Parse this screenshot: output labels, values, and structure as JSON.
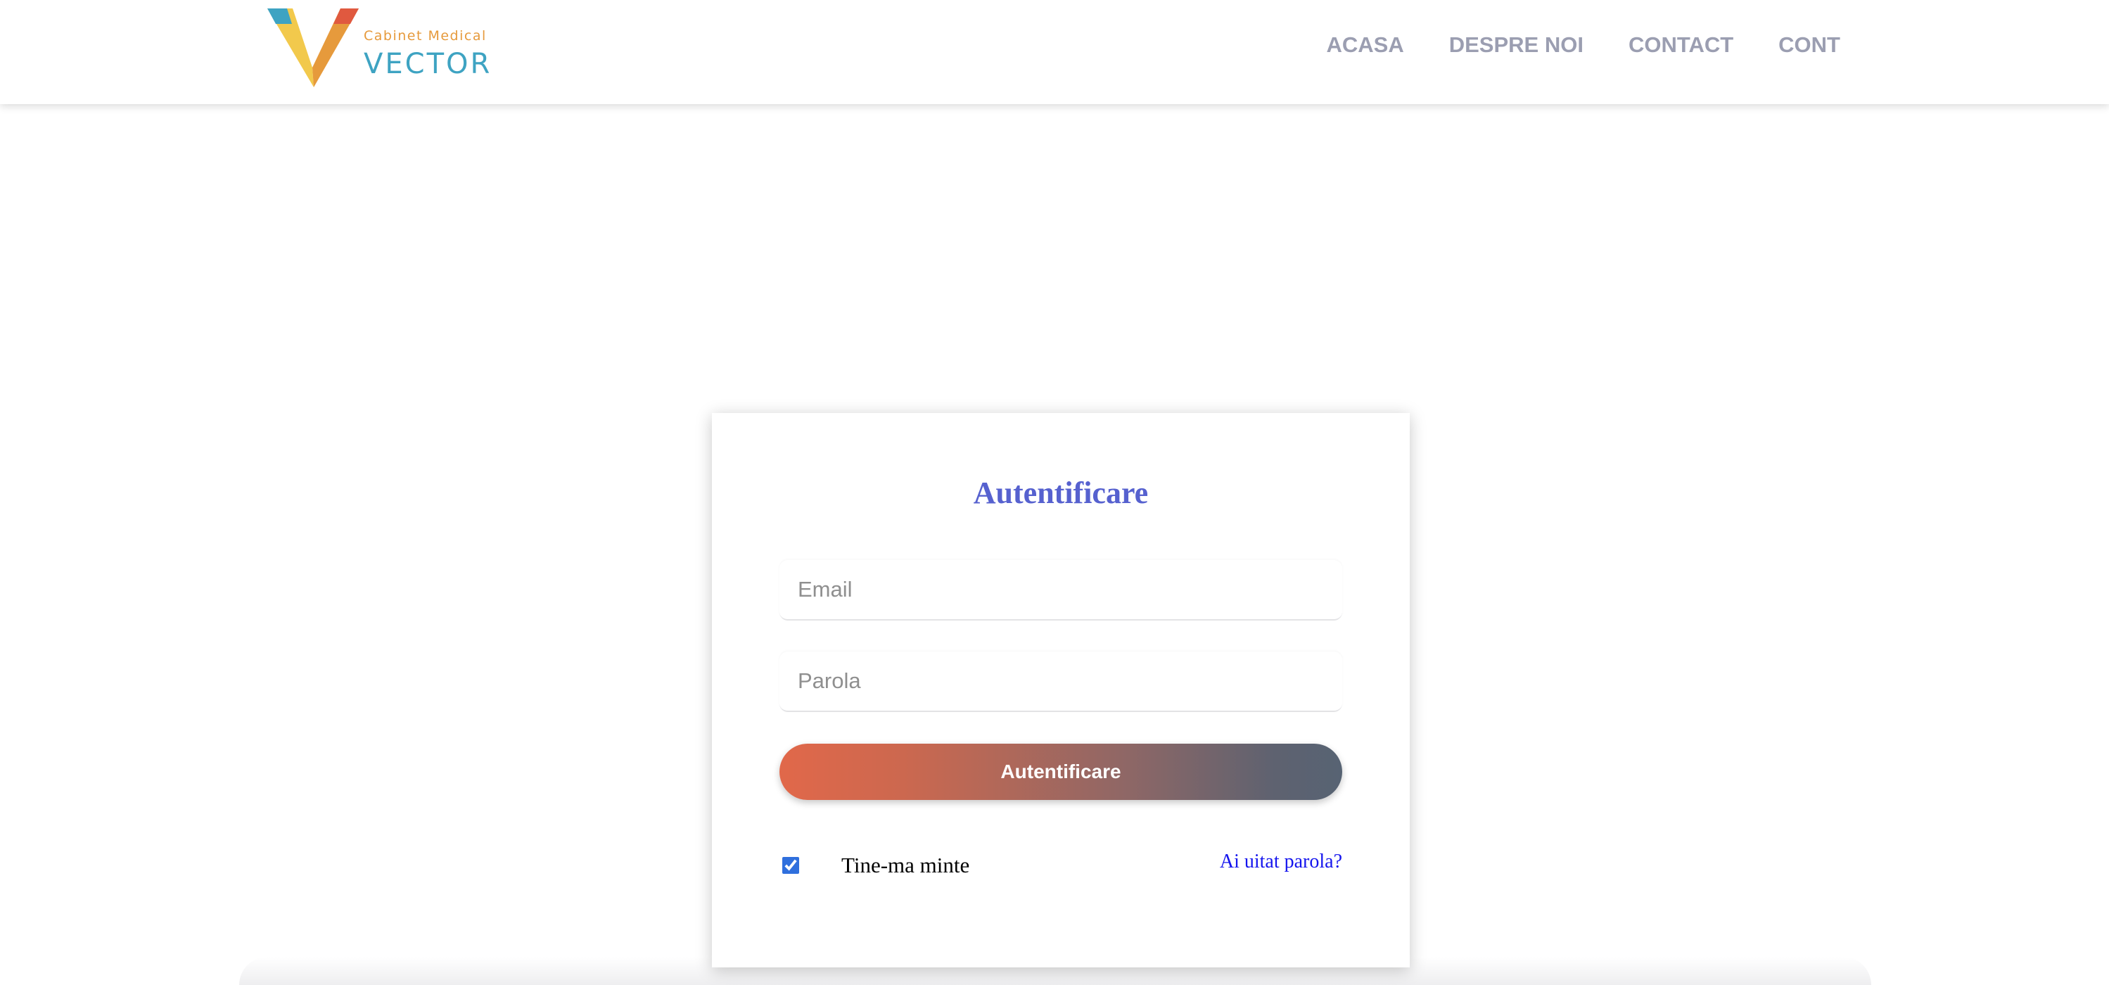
{
  "brand": {
    "tagline": "Cabinet Medical",
    "name": "VECTOR",
    "colors": {
      "teal": "#3ea3c2",
      "orange": "#e69a3c",
      "yellow": "#f2c94c",
      "red": "#e0593f"
    }
  },
  "nav": {
    "items": [
      {
        "label": "ACASA"
      },
      {
        "label": "DESPRE NOI"
      },
      {
        "label": "CONTACT"
      },
      {
        "label": "CONT"
      }
    ],
    "color": "#9b9eb1"
  },
  "login": {
    "title": "Autentificare",
    "email_placeholder": "Email",
    "password_placeholder": "Parola",
    "submit_label": "Autentificare",
    "remember_label": "Tine-ma minte",
    "remember_checked": true,
    "forgot_label": "Ai uitat parola?",
    "colors": {
      "title": "#5661cf",
      "button_start": "#e1684a",
      "button_end": "#576373",
      "link": "#1515ee"
    }
  }
}
